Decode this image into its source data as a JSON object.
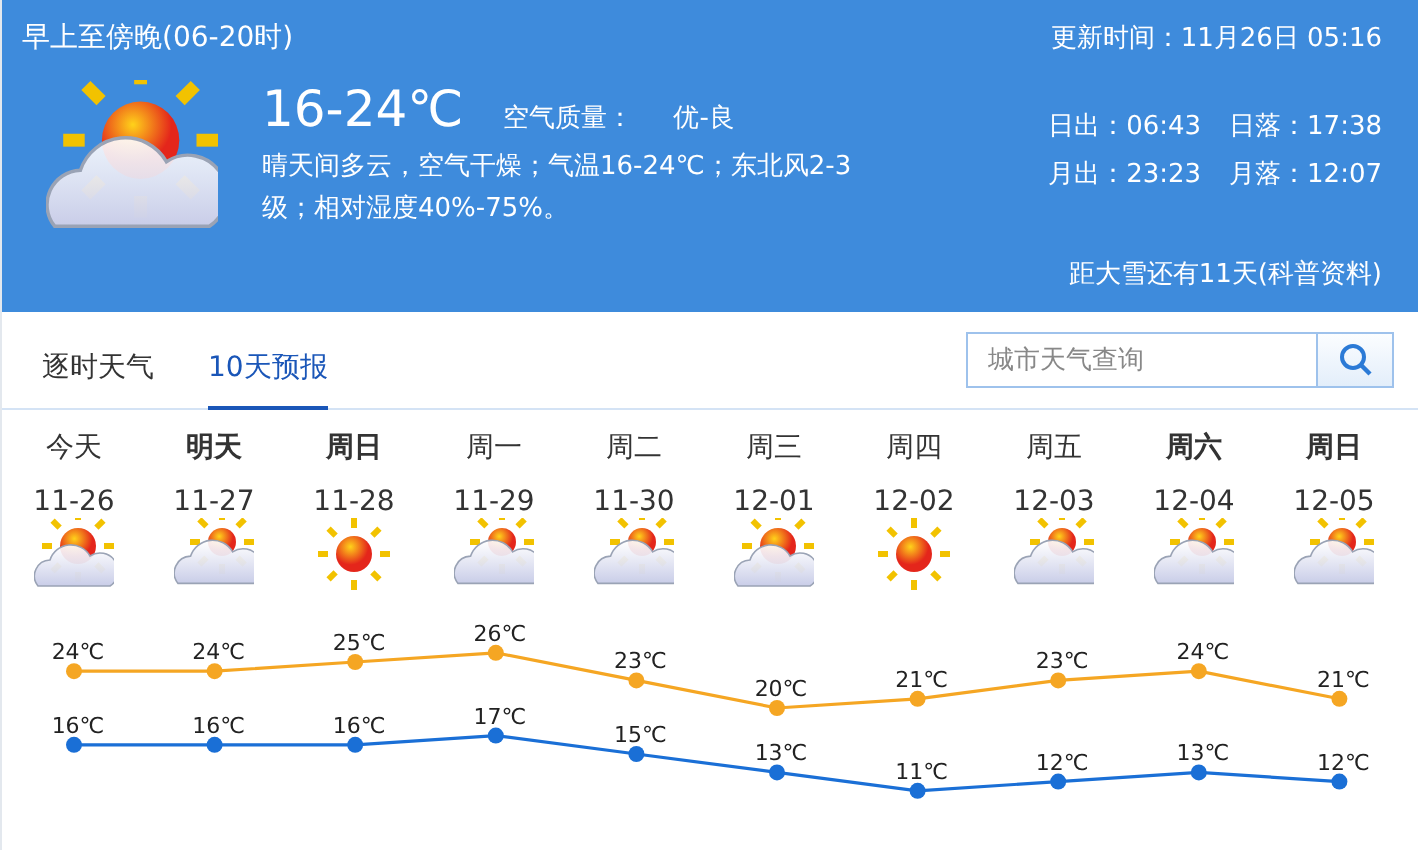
{
  "header": {
    "period": "早上至傍晚(06-20时)",
    "updated": "更新时间：11月26日 05:16",
    "icon": {
      "kind": "sun-cloud"
    },
    "temperature": "16-24℃",
    "air_quality_label": "空气质量：",
    "air_quality": "优-良",
    "description": "晴天间多云，空气干燥；气温16-24℃；东北风2-3级；相对湿度40%-75%。",
    "astro": [
      {
        "label": "日出：",
        "value": "06:43"
      },
      {
        "label": "日落：",
        "value": "17:38"
      },
      {
        "label": "月出：",
        "value": "23:23"
      },
      {
        "label": "月落：",
        "value": "12:07"
      }
    ],
    "countdown": "距大雪还有11天(科普资料)"
  },
  "tabs": [
    {
      "label": "逐时天气",
      "selected": false
    },
    {
      "label": "10天预报",
      "selected": true
    }
  ],
  "search": {
    "placeholder": "城市天气查询"
  },
  "days": [
    {
      "day": "今天",
      "highlight": false,
      "date": "11-26",
      "kind": "sun-cloud"
    },
    {
      "day": "明天",
      "highlight": true,
      "date": "11-27",
      "kind": "cloud-sun"
    },
    {
      "day": "周日",
      "highlight": true,
      "date": "11-28",
      "kind": "sun"
    },
    {
      "day": "周一",
      "highlight": false,
      "date": "11-29",
      "kind": "cloud-sun"
    },
    {
      "day": "周二",
      "highlight": false,
      "date": "11-30",
      "kind": "cloud-sun"
    },
    {
      "day": "周三",
      "highlight": false,
      "date": "12-01",
      "kind": "sun-cloud"
    },
    {
      "day": "周四",
      "highlight": false,
      "date": "12-02",
      "kind": "sun"
    },
    {
      "day": "周五",
      "highlight": false,
      "date": "12-03",
      "kind": "cloud-sun"
    },
    {
      "day": "周六",
      "highlight": true,
      "date": "12-04",
      "kind": "cloud-sun"
    },
    {
      "day": "周日",
      "highlight": true,
      "date": "12-05",
      "kind": "cloud-sun"
    }
  ],
  "chart_data": {
    "type": "line",
    "series": [
      {
        "color": "#f5a623",
        "marker": "circle",
        "values": [
          24,
          24,
          25,
          26,
          23,
          20,
          21,
          23,
          24,
          21
        ],
        "value_labels": [
          "24℃",
          "24℃",
          "25℃",
          "26℃",
          "23℃",
          "20℃",
          "21℃",
          "23℃",
          "24℃",
          "21℃"
        ]
      },
      {
        "color": "#1a6fd6",
        "marker": "circle",
        "values": [
          16,
          16,
          16,
          17,
          15,
          13,
          11,
          12,
          13,
          12
        ],
        "value_labels": [
          "16℃",
          "16℃",
          "16℃",
          "17℃",
          "15℃",
          "13℃",
          "11℃",
          "12℃",
          "13℃",
          "12℃"
        ]
      }
    ]
  }
}
